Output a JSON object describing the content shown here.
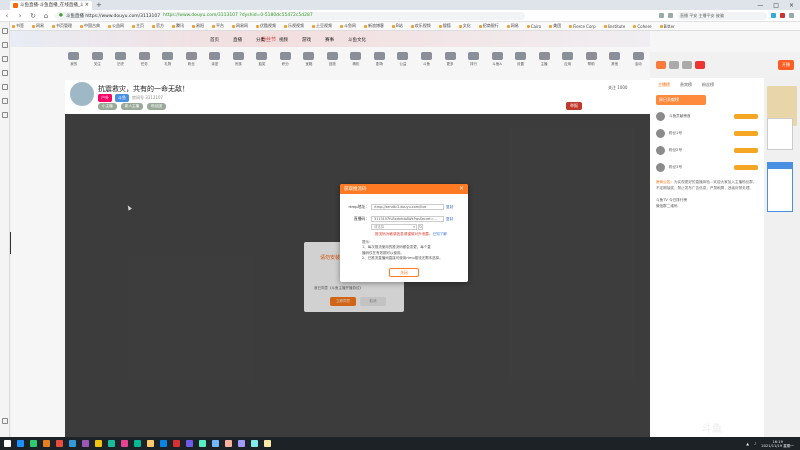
{
  "tab": {
    "title": "斗鱼直播-斗鱼直播_在线直播_斗鱼直播"
  },
  "address": {
    "domain": "斗鱼直播 https://www.douyu.com/3113107",
    "url": "https://www.douyu.com/3113107 ?dyshid=0-5180dc55472c5d287",
    "search": "直播 平安 主播平安 被骗"
  },
  "bookmarks": [
    "书签",
    "网易",
    "书页管理",
    "中国古典",
    "公益网",
    "主页",
    "官方",
    "腾讯",
    "易阳",
    "平台",
    "网易网",
    "优酷视频",
    "乐视视频",
    "土豆视频",
    "斗鱼网",
    "新浪博客",
    "B站",
    "欢乐视频",
    "搜狐",
    "文化",
    "招商银行",
    "网易",
    "Cairo",
    "美团",
    "Fierce Corp",
    "Iinstitute",
    "Cohere",
    "Bitter"
  ],
  "banner": {
    "text": "粉丝节",
    "nav": [
      "首页",
      "直播",
      "分类",
      "视频",
      "游戏",
      "赛事",
      "斗鱼文化"
    ]
  },
  "level": "12",
  "icons": [
    "我的",
    "关注",
    "历史",
    "任务",
    "礼物",
    "粉丝",
    "亲密",
    "贵族",
    "抽奖",
    "积分",
    "宝箱",
    "回放",
    "精彩",
    "剧场",
    "公益",
    "斗鱼",
    "更多",
    "排行",
    "斗鱼A",
    "设置",
    "主播",
    "应用",
    "帮助",
    "其他",
    "活动"
  ],
  "right_top": {
    "btn": "开播",
    "label": "我"
  },
  "streamer": {
    "title": "抗震救灾，共有的一命无敌！",
    "tag1": "户外",
    "tag2": "斗鱼",
    "sub": "房间号 3113107",
    "follow": "关注 1000"
  },
  "tags": [
    "小主播",
    "新人主播",
    "粉丝团"
  ],
  "report": "举报",
  "bg_dialog": {
    "header": "请勿安装",
    "check": "我已同意《斗鱼主播开播协议》",
    "ok": "立即同意",
    "cancel": "取消"
  },
  "dialog": {
    "title": "获取推流码",
    "rtmp_label": "rtmp地址：",
    "rtmp_value": "rtmp://sendtc3.douyu.com/live",
    "key_label": "直播码：",
    "key_value": "3113107rLBxdxfcbAWk?wsSecret=...",
    "copy": "复制",
    "select_placeholder": "请选择",
    "warn": "推流码为敏感信息请谨慎对外泄露。",
    "warn_link": "已知了解",
    "tips_head": "提示：",
    "tips": [
      "1、每次推流使用的推流码都会变更，每个直",
      "播码仅在有效期可以使用。",
      "2、已推流直播间直接可使用rtmp推流无需本选择。"
    ],
    "close": "关闭"
  },
  "right_panel": {
    "tabs": [
      "主播榜",
      "贵宾榜",
      "粉丝榜"
    ],
    "header": "周日贡献榜",
    "ranks": [
      "斗鱼贡献榜首",
      "粉丝1号",
      "粉丝2号",
      "粉丝3号"
    ],
    "notice_head": "房间公告：",
    "notice": "为实现更好的直播体验...欢迎大家加入主播粉丝群，不定期抽奖，禁止发布广告信息，严禁刷屏，违者封禁处理。",
    "links": [
      "斗鱼TV 今日排行榜",
      "微信群二维码"
    ]
  },
  "taskbar": {
    "time": "16:19",
    "date": "2021/11/19 星期一"
  },
  "watermark": {
    "big": "斗鱼",
    "small": "DOUYU.COM"
  }
}
